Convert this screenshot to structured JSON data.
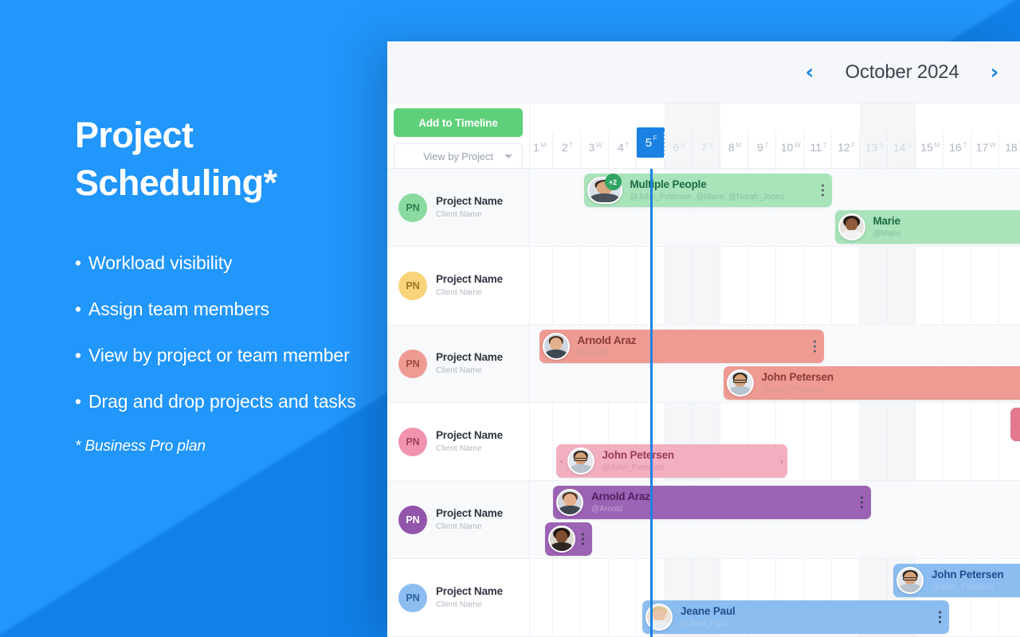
{
  "marketing": {
    "headline_line1": "Project",
    "headline_line2": "Scheduling*",
    "bullet_marker": "•",
    "bullets": [
      "Workload visibility",
      "Assign team members",
      "View by project or team member",
      "Drag and drop projects and tasks"
    ],
    "footnote": "* Business Pro plan",
    "brand_blue": "#1d90f5"
  },
  "app": {
    "header": {
      "prev_label": "‹",
      "month_label": "October 2024",
      "next_label": "›"
    },
    "toolbar": {
      "add_button_label": "Add to Timeline",
      "view_select_value": "View by Project",
      "view_select_caret": "chevron-down",
      "add_button_color": "#5fd07a"
    },
    "ruler": {
      "today_day": 5,
      "days": [
        {
          "n": "1",
          "wd": "M",
          "weekend": false
        },
        {
          "n": "2",
          "wd": "T",
          "weekend": false
        },
        {
          "n": "3",
          "wd": "W",
          "weekend": false
        },
        {
          "n": "4",
          "wd": "T",
          "weekend": false
        },
        {
          "n": "5",
          "wd": "F",
          "weekend": false,
          "today": true
        },
        {
          "n": "6",
          "wd": "S",
          "weekend": true
        },
        {
          "n": "7",
          "wd": "S",
          "weekend": true
        },
        {
          "n": "8",
          "wd": "M",
          "weekend": false
        },
        {
          "n": "9",
          "wd": "T",
          "weekend": false
        },
        {
          "n": "10",
          "wd": "W",
          "weekend": false
        },
        {
          "n": "11",
          "wd": "T",
          "weekend": false
        },
        {
          "n": "12",
          "wd": "F",
          "weekend": false
        },
        {
          "n": "13",
          "wd": "S",
          "weekend": true
        },
        {
          "n": "14",
          "wd": "S",
          "weekend": true
        },
        {
          "n": "15",
          "wd": "M",
          "weekend": false
        },
        {
          "n": "16",
          "wd": "T",
          "weekend": false
        },
        {
          "n": "17",
          "wd": "W",
          "weekend": false
        },
        {
          "n": "18",
          "wd": "T",
          "weekend": false
        }
      ]
    },
    "projects": [
      {
        "initials": "PN",
        "name": "Project Name",
        "client": "Client Name",
        "color": "#8adaa0",
        "text": "#2e7d4f",
        "alt": true
      },
      {
        "initials": "PN",
        "name": "Project Name",
        "client": "Client Name",
        "color": "#f8d37a",
        "text": "#9c7322",
        "alt": false
      },
      {
        "initials": "PN",
        "name": "Project Name",
        "client": "Client Name",
        "color": "#ee9b93",
        "text": "#9d4a42",
        "alt": true
      },
      {
        "initials": "PN",
        "name": "Project Name",
        "client": "Client Name",
        "color": "#f193ad",
        "text": "#9d3f5e",
        "alt": false
      },
      {
        "initials": "PN",
        "name": "Project Name",
        "client": "Client Name",
        "color": "#9355ab",
        "text": "#ffffff",
        "alt": true
      },
      {
        "initials": "PN",
        "name": "Project Name",
        "client": "Client Name",
        "color": "#8cbdf0",
        "text": "#2a5f9e",
        "alt": false
      }
    ],
    "bars": [
      {
        "id": "bar-multiple-people",
        "row": 0,
        "lane": 0,
        "start_day": 2.1,
        "span_days": 8.9,
        "title": "Multiple People",
        "handle": "@John_Petersen ,@Marie, @Norah_Jones",
        "fill": "#a9e3ba",
        "tone": "green",
        "avatar": "double",
        "badge": "+2",
        "badge_color": "#2fa463",
        "kebab": true,
        "grip_left": false,
        "grip_right": false
      },
      {
        "id": "bar-marie",
        "row": 0,
        "lane": 1,
        "start_day": 11.1,
        "span_days": 8.0,
        "title": "Marie",
        "handle": "@Marie",
        "fill": "#a9e3ba",
        "tone": "green",
        "avatar": "woman-curly",
        "badge": null,
        "kebab": false,
        "grip_left": false,
        "grip_right": false
      },
      {
        "id": "bar-row2-amber",
        "row": 1,
        "lane": 1,
        "start_day": 18.1,
        "span_days": 2.4,
        "title": "",
        "handle": "",
        "fill": "#fbdf9e",
        "tone": "amber",
        "avatar": "woman-curly",
        "badge": null,
        "kebab": false,
        "grip_left": false,
        "grip_right": false
      },
      {
        "id": "bar-arnold-araz-red",
        "row": 2,
        "lane": 0,
        "start_day": 0.5,
        "span_days": 10.2,
        "title": "Arnold Araz",
        "handle": "@Arnold",
        "fill": "#ee9b93",
        "tone": "red",
        "avatar": "man-beard",
        "badge": null,
        "kebab": true,
        "grip_left": false,
        "grip_right": false
      },
      {
        "id": "bar-john-petersen-red",
        "row": 2,
        "lane": 1,
        "start_day": 7.1,
        "span_days": 11.0,
        "title": "John Petersen",
        "handle": "@John_Petersen",
        "fill": "#ee9b93",
        "tone": "red",
        "avatar": "man-glasses",
        "badge": null,
        "kebab": false,
        "grip_left": false,
        "grip_right": false
      },
      {
        "id": "bar-row4-pink-edge",
        "row": 3,
        "lane": 0,
        "start_day": 17.4,
        "span_days": 2.0,
        "title": "",
        "handle": "",
        "fill": "#e3788f",
        "tone": "pink",
        "avatar": null,
        "badge": null,
        "kebab": false,
        "grip_left": true,
        "grip_right": false
      },
      {
        "id": "bar-john-petersen-pink",
        "row": 3,
        "lane": 1,
        "start_day": 1.1,
        "span_days": 8.3,
        "title": "John Petersen",
        "handle": "@John_Petersen",
        "fill": "#f2afc0",
        "tone": "pink",
        "avatar": "man-glasses",
        "badge": null,
        "kebab": false,
        "grip_left": true,
        "grip_right": true
      },
      {
        "id": "bar-arnold-araz-purple",
        "row": 4,
        "lane": 0,
        "start_day": 1.0,
        "span_days": 11.4,
        "title": "Arnold Araz",
        "handle": "@Arnold",
        "fill": "#9c62b4",
        "tone": "purple",
        "avatar": "man-beard",
        "badge": null,
        "kebab": true,
        "grip_left": false,
        "grip_right": false
      },
      {
        "id": "bar-row5-purple-small",
        "row": 4,
        "lane": 1,
        "start_day": 0.7,
        "span_days": 1.7,
        "title": "",
        "handle": "",
        "fill": "#9c62b4",
        "tone": "purple",
        "avatar": "woman-dark",
        "badge": null,
        "kebab": true,
        "grip_left": false,
        "grip_right": false
      },
      {
        "id": "bar-john-petersen-blue",
        "row": 5,
        "lane": 0,
        "start_day": 13.2,
        "span_days": 6.0,
        "title": "John Petersen",
        "handle": "@John_Petersen",
        "fill": "#8cbdf0",
        "tone": "blue",
        "avatar": "man-glasses",
        "badge": null,
        "kebab": false,
        "grip_left": false,
        "grip_right": false
      },
      {
        "id": "bar-jeane-paul-blue",
        "row": 5,
        "lane": 1,
        "start_day": 4.2,
        "span_days": 11.0,
        "title": "Jeane Paul",
        "handle": "@Jean_Paul",
        "fill": "#8cbdf0",
        "tone": "blue",
        "avatar": "woman-blonde",
        "badge": null,
        "kebab": true,
        "grip_left": false,
        "grip_right": false
      }
    ]
  }
}
